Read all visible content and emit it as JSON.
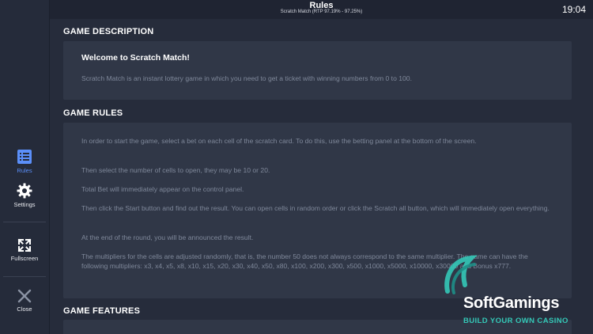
{
  "header": {
    "title": "Rules",
    "subtitle": "Scratch Match (RTP 97.19% - 97.25%)",
    "clock": "19:04"
  },
  "sidebar": {
    "items": [
      {
        "label": "Rules",
        "icon": "list-icon",
        "active": true
      },
      {
        "label": "Settings",
        "icon": "gear-icon",
        "active": false
      },
      {
        "label": "Fullscreen",
        "icon": "fullscreen-icon",
        "active": false
      },
      {
        "label": "Close",
        "icon": "close-icon",
        "active": false
      }
    ]
  },
  "sections": {
    "description": {
      "title": "GAME DESCRIPTION",
      "welcome": "Welcome to Scratch Match!",
      "text": "Scratch Match is an instant lottery game in which you need to get a ticket with winning numbers from 0 to 100."
    },
    "rules": {
      "title": "GAME RULES",
      "paragraphs": [
        "In order to start the game, select a bet on each cell of the scratch card. To do this, use the betting panel at the bottom of the screen.",
        "Then select the number of cells to open, they may be 10 or 20.",
        "Total Bet will immediately appear on the control panel.",
        "Then click the Start button and find out the result. You can open cells in random order or click the Scratch all button, which will immediately open everything.",
        "At the end of the round, you will be announced the result.",
        "The multipliers for the cells are adjusted randomly, that is, the number 50 does not always correspond to the same multiplier. The game can have the following multipliers: x3, x4, x5, x8, x10, x15, x20, x30, x40, x50, x80, x100, x200, x300, x500, x1000, x5000, x10000, x30000 and Bonus x777."
      ]
    },
    "features": {
      "title": "GAME FEATURES"
    }
  },
  "watermark": {
    "brand": "SoftGamings",
    "tagline": "BUILD YOUR OWN CASINO"
  },
  "colors": {
    "accent": "#5b8ff9",
    "background": "#262c3b",
    "card": "#303747",
    "watermark_accent": "#34c8b7"
  }
}
